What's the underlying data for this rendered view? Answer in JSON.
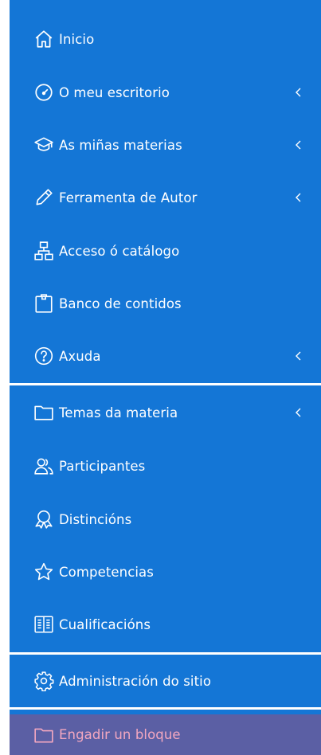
{
  "nav": {
    "inicio": "Inicio",
    "escritorio": "O meu escritorio",
    "materias": "As miñas materias",
    "autor": "Ferramenta de Autor",
    "catalogo": "Acceso ó catálogo",
    "banco": "Banco de contidos",
    "axuda": "Axuda"
  },
  "course": {
    "temas": "Temas da materia",
    "participantes": "Participantes",
    "distincions": "Distincións",
    "competencias": "Competencias",
    "cualificacions": "Cualificacións"
  },
  "admin": {
    "sitio": "Administración do sitio"
  },
  "block": {
    "engadir": "Engadir un bloque"
  },
  "colors": {
    "sidebar_bg": "#1476d6",
    "add_block_bg": "#5b5fa4",
    "add_block_text": "#f4a8c0"
  }
}
